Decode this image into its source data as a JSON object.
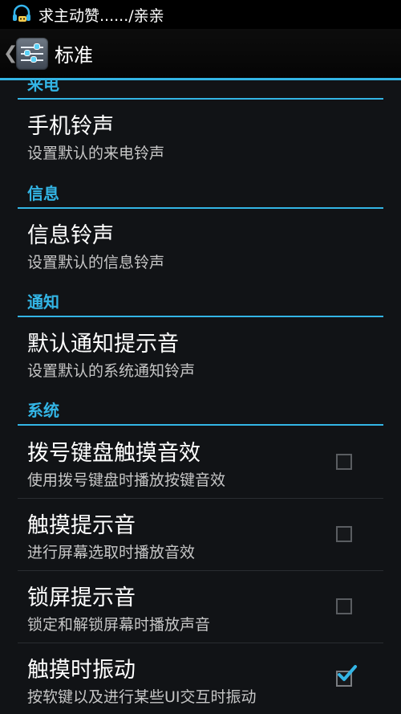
{
  "status_bar": {
    "notification_text": "求主动赞....../亲亲",
    "icon": "headset-chat-icon"
  },
  "action_bar": {
    "back_icon": "chevron-left-icon",
    "app_icon": "sliders-settings-icon",
    "title": "标准"
  },
  "colors": {
    "accent": "#33b5e5",
    "background": "#111316",
    "summary_text": "#c6c6c6"
  },
  "sections": {
    "incoming": {
      "header": "来电",
      "items": [
        {
          "title": "手机铃声",
          "summary": "设置默认的来电铃声"
        }
      ]
    },
    "messages": {
      "header": "信息",
      "items": [
        {
          "title": "信息铃声",
          "summary": "设置默认的信息铃声"
        }
      ]
    },
    "notification": {
      "header": "通知",
      "items": [
        {
          "title": "默认通知提示音",
          "summary": "设置默认的系统通知铃声"
        }
      ]
    },
    "system": {
      "header": "系统",
      "items": [
        {
          "title": "拨号键盘触摸音效",
          "summary": "使用拨号键盘时播放按键音效",
          "checked": false
        },
        {
          "title": "触摸提示音",
          "summary": "进行屏幕选取时播放音效",
          "checked": false
        },
        {
          "title": "锁屏提示音",
          "summary": "锁定和解锁屏幕时播放声音",
          "checked": false
        },
        {
          "title": "触摸时振动",
          "summary": "按软键以及进行某些UI交互时振动",
          "checked": true
        }
      ]
    }
  }
}
